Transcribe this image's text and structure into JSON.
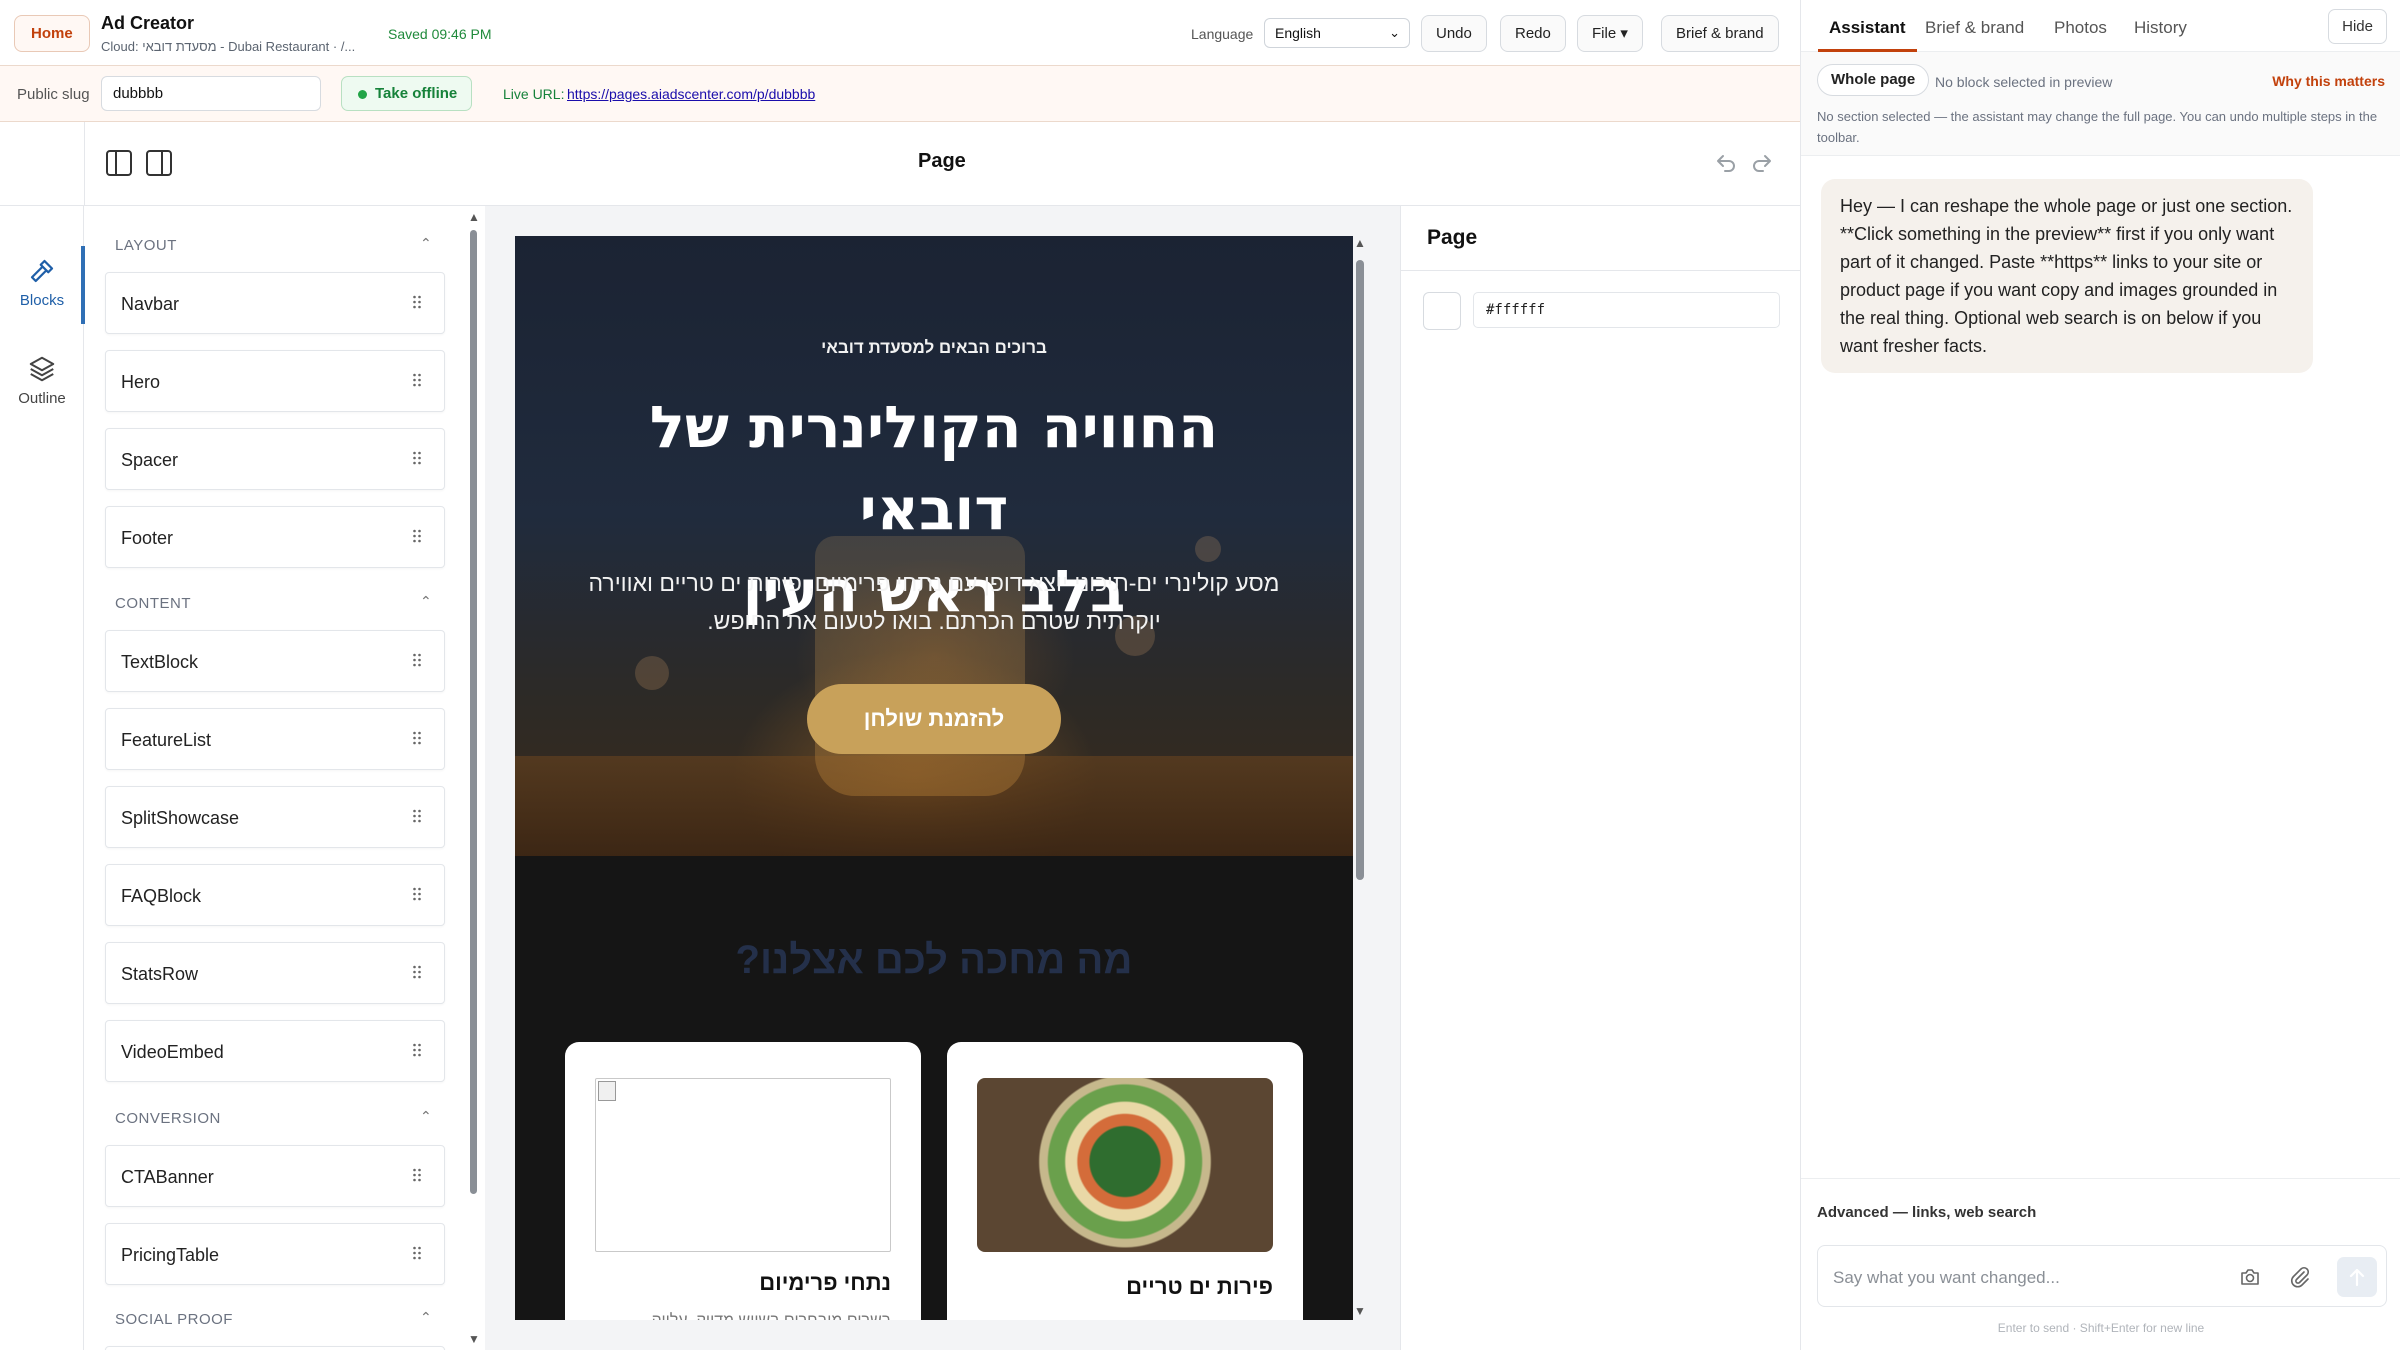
{
  "topbar": {
    "home_label": "Home",
    "app_title": "Ad Creator",
    "project_subtitle": "Cloud: מסעדת דובאי - Dubai Restaurant · /...",
    "saved_status": "Saved 09:46 PM",
    "language_label": "Language",
    "language_value": "English",
    "undo_label": "Undo",
    "redo_label": "Redo",
    "file_label": "File ▾",
    "brief_label": "Brief & brand"
  },
  "slugbar": {
    "slug_label": "Public slug",
    "slug_value": "dubbbb",
    "offline_label": "Take offline",
    "live_label": "Live URL:",
    "live_url": "https://pages.aiadscenter.com/p/dubbbb"
  },
  "editor": {
    "page_title": "Page"
  },
  "rail": {
    "blocks_label": "Blocks",
    "outline_label": "Outline"
  },
  "palette": {
    "sections": [
      {
        "title": "LAYOUT",
        "items": [
          "Navbar",
          "Hero",
          "Spacer",
          "Footer"
        ]
      },
      {
        "title": "CONTENT",
        "items": [
          "TextBlock",
          "FeatureList",
          "SplitShowcase",
          "FAQBlock",
          "StatsRow",
          "VideoEmbed"
        ]
      },
      {
        "title": "CONVERSION",
        "items": [
          "CTABanner",
          "PricingTable"
        ]
      },
      {
        "title": "SOCIAL PROOF",
        "items": []
      }
    ]
  },
  "preview": {
    "hero_eyebrow": "ברוכים הבאים למסעדת דובאי",
    "hero_title_line1": "החוויה הקולינרית של דובאי",
    "hero_title_line2": "בלב ראש העין",
    "hero_subtitle": "מסע קולינרי ים-תיכוני יוצא דופן עם נתחי פרימיום, פירות ים טריים ואווירה יוקרתית שטרם הכרתם. בואו לטעום את החופש.",
    "hero_cta": "להזמנת שולחן",
    "services_title": "מה מחכה לכם אצלנו?",
    "cards": [
      {
        "title": "נתחי פרימיום",
        "desc": "בשרים מובחרים בשיוש מדויק, עלייה"
      },
      {
        "title": "פירות ים טריים",
        "desc": ""
      }
    ]
  },
  "inspector": {
    "title": "Page",
    "background_color": "#ffffff"
  },
  "assistant": {
    "tabs": [
      "Assistant",
      "Brief & brand",
      "Photos",
      "History"
    ],
    "active_tab": "Assistant",
    "hide_label": "Hide",
    "scope_label": "Whole page",
    "scope_note": "No block selected in preview",
    "why_label": "Why this matters",
    "scope_help": "No section selected — the assistant may change the full page. You can undo multiple steps in the toolbar.",
    "message": "Hey — I can reshape the whole page or just one section. **Click something in the preview** first if you only want part of it changed. Paste **https** links to your site or product page if you want copy and images grounded in the real thing. Optional web search is on below if you want fresher facts.",
    "advanced_label": "Advanced — links, web search",
    "input_placeholder": "Say what you want changed...",
    "hint": "Enter to send · Shift+Enter for new line"
  },
  "colors": {
    "accent": "#c2410c",
    "online_green": "#16823a",
    "cta_gold": "#c8a15a",
    "selected_blue": "#1f5fa8"
  },
  "icons": [
    "panel-left-icon",
    "panel-right-icon",
    "undo-arrow-icon",
    "redo-arrow-icon",
    "hammer-icon",
    "layers-icon",
    "drag-handle-icon",
    "camera-icon",
    "paperclip-icon",
    "send-arrow-icon",
    "chevron-up-icon"
  ]
}
